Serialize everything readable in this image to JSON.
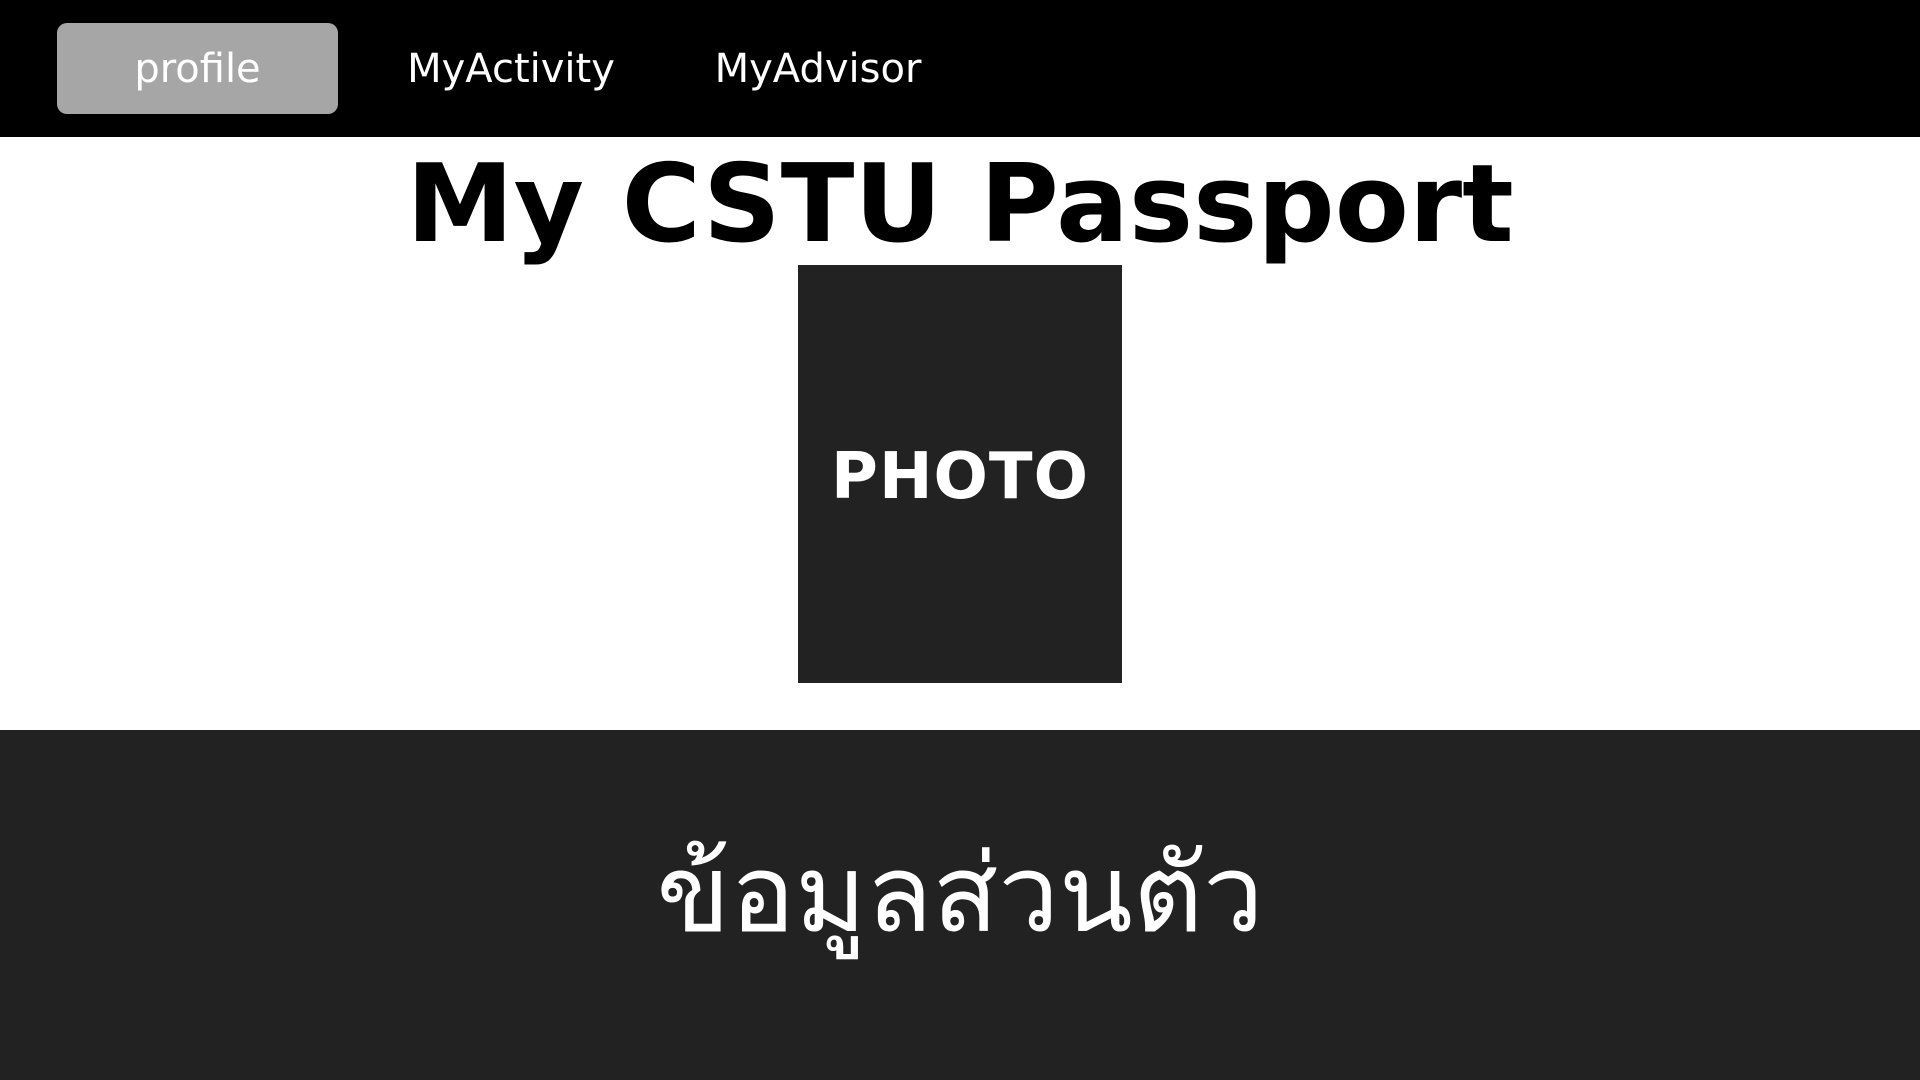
{
  "nav": {
    "items": [
      {
        "label": "profile",
        "active": true
      },
      {
        "label": "MyActivity",
        "active": false
      },
      {
        "label": "MyAdvisor",
        "active": false
      }
    ]
  },
  "main": {
    "title": "My CSTU Passport",
    "photo_placeholder": "PHOTO"
  },
  "section": {
    "title": "ข้อมูลส่วนตัว"
  },
  "colors": {
    "topbar": "#000000",
    "active_tab": "#a6a6a6",
    "dark_panel": "#222222",
    "background": "#ffffff"
  }
}
